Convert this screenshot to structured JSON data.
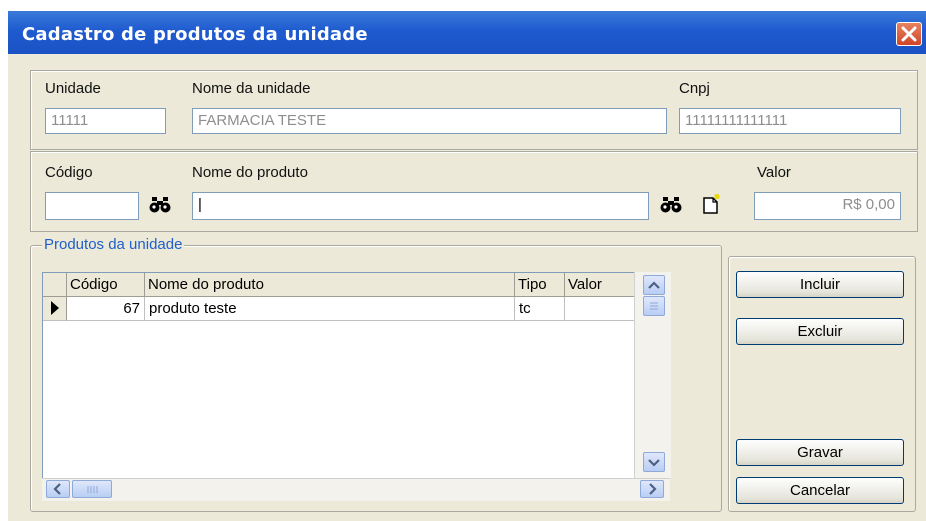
{
  "window": {
    "title": "Cadastro de produtos da unidade"
  },
  "unidade": {
    "unidade_label": "Unidade",
    "unidade_value": "11111",
    "nome_label": "Nome da unidade",
    "nome_value": "FARMACIA TESTE",
    "cnpj_label": "Cnpj",
    "cnpj_value": "11111111111111"
  },
  "produto": {
    "codigo_label": "Código",
    "codigo_value": "",
    "nome_label": "Nome do produto",
    "nome_value": "|",
    "valor_label": "Valor",
    "valor_value": "R$ 0,00"
  },
  "group": {
    "title": "Produtos da unidade"
  },
  "table": {
    "headers": [
      "Código",
      "Nome do produto",
      "Tipo",
      "Valor"
    ],
    "rows": [
      {
        "codigo": "67",
        "nome": "produto teste",
        "tipo": "tc",
        "valor": ""
      }
    ]
  },
  "buttons": {
    "incluir": "Incluir",
    "excluir": "Excluir",
    "gravar": "Gravar",
    "cancelar": "Cancelar"
  },
  "icons": {
    "search": "binoculars-icon",
    "new": "new-document-icon",
    "close": "close-icon"
  }
}
